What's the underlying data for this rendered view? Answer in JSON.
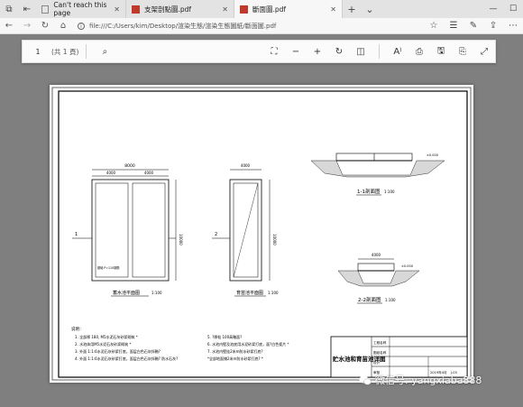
{
  "browser": {
    "tabs": [
      {
        "label": "Can't reach this page",
        "active": false
      },
      {
        "label": "支架剖點圖.pdf",
        "active": false
      },
      {
        "label": "斷面圖.pdf",
        "active": true
      }
    ],
    "url": "file:///C:/Users/kim/Desktop/渲染生態/渲染生態圖紙/斷面圖.pdf"
  },
  "pdf_toolbar": {
    "page_number": "1",
    "page_count": "(共 1 頁)"
  },
  "drawing": {
    "plan1": {
      "dim_total": "8000",
      "dim_left": "4000",
      "dim_right": "4000",
      "dim_side": "10000",
      "marker": "1",
      "note": "基础 P=110钢筋",
      "caption": "蓄水池平面图",
      "scale": "1:100"
    },
    "plan2": {
      "dim_top": "4000",
      "dim_side": "10000",
      "marker": "2",
      "caption": "育苗池平面图",
      "scale": "1:100"
    },
    "section1": {
      "note": "±0.000",
      "caption": "1-1剖面图",
      "scale": "1:100"
    },
    "section2": {
      "dim_top": "4000",
      "note": "±0.000",
      "caption": "2-2剖面图",
      "scale": "1:100"
    },
    "notes": {
      "heading": "说明：",
      "left": [
        "1. 全部厚 180, M5水泥石灰砂浆砌筑 *",
        "2. 水池体用M5水泥石灰砂浆砌筑 *",
        "3. 外面 1:1:6水泥石灰砂浆打底，面层白色石灰拌釉?",
        "4. 外面 1:1:6水泥石灰砂浆打底，面层白色石灰拌釉? 防水石灰?"
      ],
      "right": [
        "5. ?厚帖 100高釉面?",
        "6. 水池内壁及池底用水泥砂浆打底，面?白色瓷片 *",
        "7. 水池内壁挂2米m防水砂浆打底?",
        "*全部地面铺2米m防水砂浆打底? *"
      ]
    },
    "titleblock": {
      "title": "贮水池和育苗池详图",
      "r1": "工程名称",
      "r2": "图纸名称",
      "r3": "设计",
      "r4": "审核",
      "date": "2019年4月",
      "no": "J-03"
    }
  },
  "watermark": "微信号: yangxiaba888"
}
